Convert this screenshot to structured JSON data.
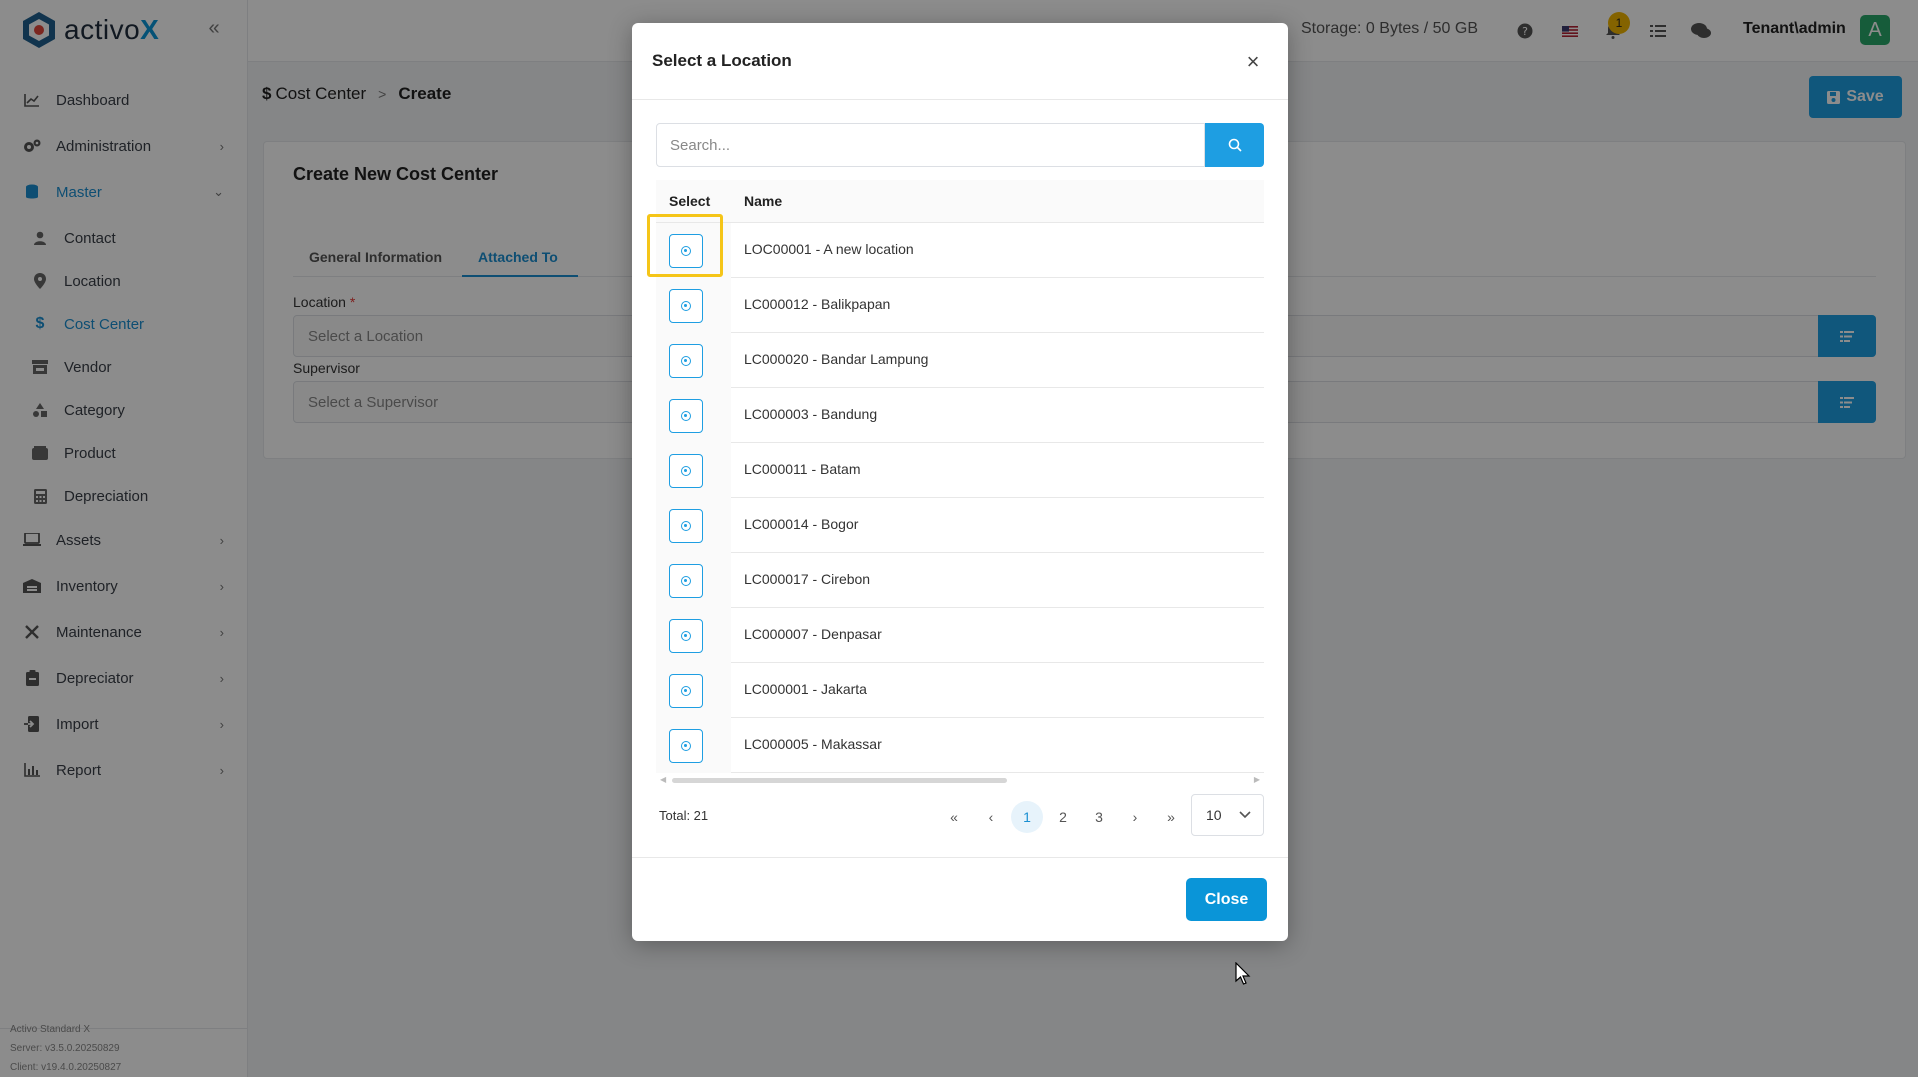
{
  "app": {
    "logo_text_main": "activo",
    "logo_text_accent": "X",
    "brand_color": "#0a95d8",
    "accent_color": "#1e9ee2"
  },
  "sidebar": {
    "items": [
      {
        "label": "Dashboard",
        "icon": "chart-line-icon"
      },
      {
        "label": "Administration",
        "icon": "gears-icon"
      },
      {
        "label": "Master",
        "icon": "database-icon"
      },
      {
        "label": "Contact",
        "icon": "user-icon"
      },
      {
        "label": "Location",
        "icon": "map-pin-icon"
      },
      {
        "label": "Cost Center",
        "icon": "dollar-icon"
      },
      {
        "label": "Vendor",
        "icon": "store-icon"
      },
      {
        "label": "Category",
        "icon": "shapes-icon"
      },
      {
        "label": "Product",
        "icon": "box-icon"
      },
      {
        "label": "Depreciation",
        "icon": "calculator-icon"
      },
      {
        "label": "Assets",
        "icon": "laptop-icon"
      },
      {
        "label": "Inventory",
        "icon": "warehouse-icon"
      },
      {
        "label": "Maintenance",
        "icon": "tools-icon"
      },
      {
        "label": "Depreciator",
        "icon": "clipboard-icon"
      },
      {
        "label": "Import",
        "icon": "file-import-icon"
      },
      {
        "label": "Report",
        "icon": "chart-bar-icon"
      }
    ],
    "footer": {
      "product": "Activo Standard X",
      "server": "Server: v3.5.0.20250829",
      "client": "Client: v19.4.0.20250827"
    }
  },
  "topbar": {
    "storage": "Storage: 0 Bytes / 50 GB",
    "notification_count": "1",
    "user": "Tenant\\admin",
    "avatar_letter": "A"
  },
  "breadcrumb": {
    "icon": "$",
    "root": "Cost Center",
    "current": "Create"
  },
  "toolbar": {
    "save_label": "Save"
  },
  "form": {
    "title": "Create New Cost Center",
    "tabs": [
      "General Information",
      "Attached To"
    ],
    "location_label": "Location",
    "required_mark": "*",
    "location_placeholder": "Select a Location",
    "supervisor_label": "Supervisor",
    "supervisor_placeholder": "Select a Supervisor"
  },
  "modal": {
    "title": "Select a Location",
    "search_placeholder": "Search...",
    "columns": [
      "Select",
      "Name"
    ],
    "rows": [
      "LOC00001 - A new location",
      "LC000012 - Balikpapan",
      "LC000020 - Bandar Lampung",
      "LC000003 - Bandung",
      "LC000011 - Batam",
      "LC000014 - Bogor",
      "LC000017 - Cirebon",
      "LC000007 - Denpasar",
      "LC000001 - Jakarta",
      "LC000005 - Makassar"
    ],
    "total": "Total: 21",
    "pages": [
      "1",
      "2",
      "3"
    ],
    "current_page": "1",
    "page_size": "10",
    "close_label": "Close"
  }
}
